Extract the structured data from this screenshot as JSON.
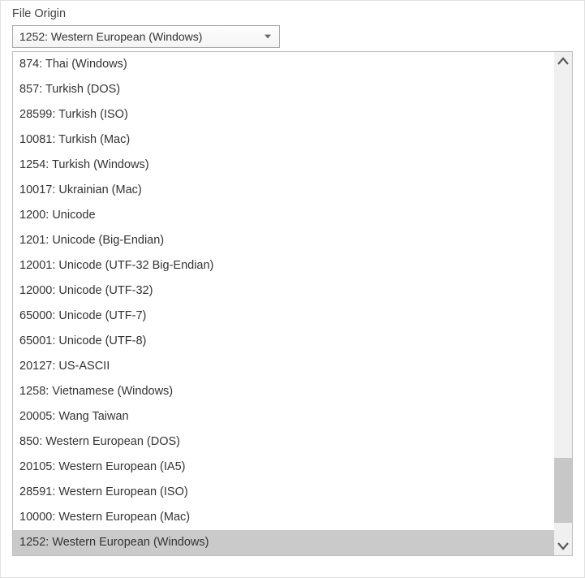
{
  "label": "File Origin",
  "selected_value": "1252: Western European (Windows)",
  "options": [
    "874: Thai (Windows)",
    "857: Turkish (DOS)",
    "28599: Turkish (ISO)",
    "10081: Turkish (Mac)",
    "1254: Turkish (Windows)",
    "10017: Ukrainian (Mac)",
    "1200: Unicode",
    "1201: Unicode (Big-Endian)",
    "12001: Unicode (UTF-32 Big-Endian)",
    "12000: Unicode (UTF-32)",
    "65000: Unicode (UTF-7)",
    "65001: Unicode (UTF-8)",
    "20127: US-ASCII",
    "1258: Vietnamese (Windows)",
    "20005: Wang Taiwan",
    "850: Western European (DOS)",
    "20105: Western European (IA5)",
    "28591: Western European (ISO)",
    "10000: Western European (Mac)",
    "1252: Western European (Windows)"
  ],
  "selected_index": 19
}
